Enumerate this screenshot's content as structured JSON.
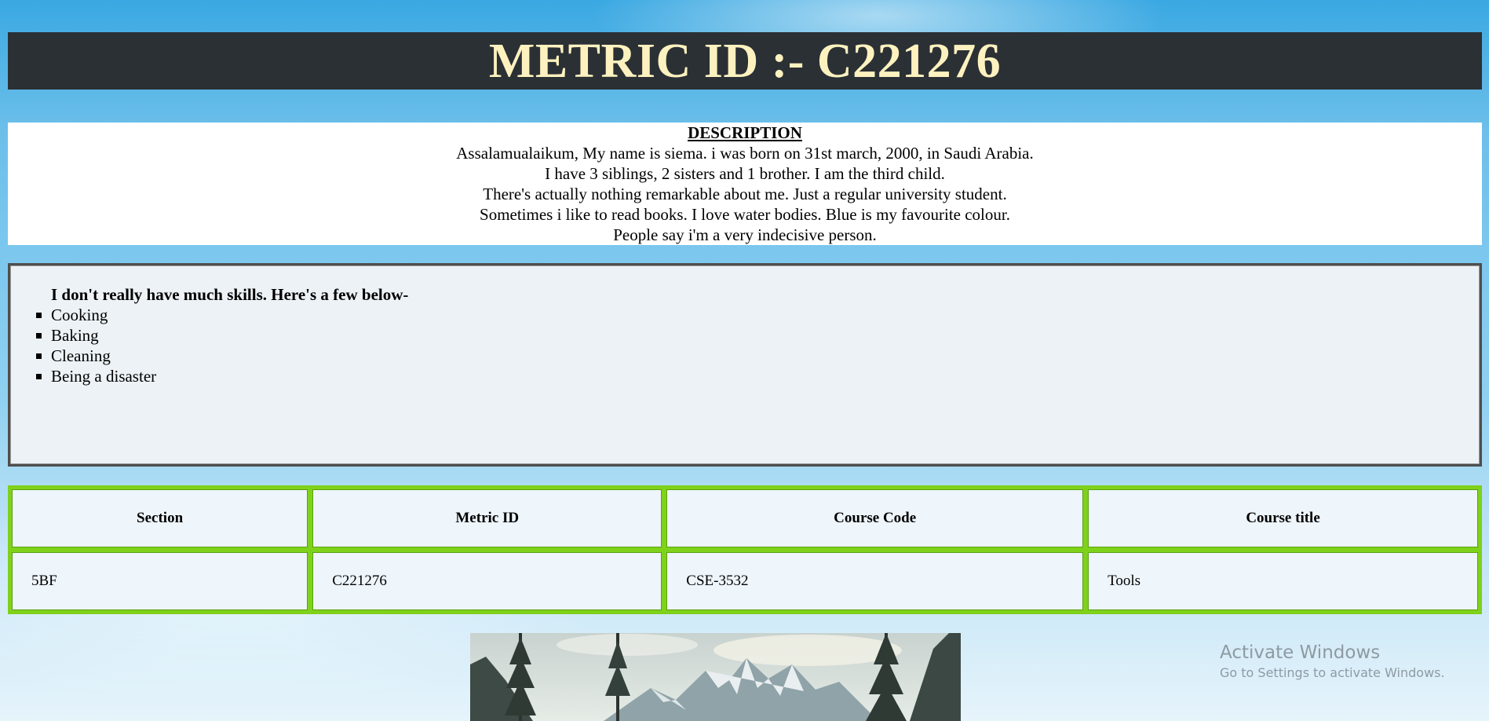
{
  "header": {
    "title": "METRIC ID :- C221276"
  },
  "description": {
    "heading": "DESCRIPTION",
    "lines": [
      "Assalamualaikum, My name is siema. i was born on 31st march, 2000, in Saudi Arabia.",
      "I have 3 siblings, 2 sisters and 1 brother. I am the third child.",
      "There's actually nothing remarkable about me. Just a regular university student.",
      "Sometimes i like to read books. I love water bodies. Blue is my favourite colour.",
      "People say i'm a very indecisive person."
    ]
  },
  "skills": {
    "intro": "I don't really have much skills. Here's a few below-",
    "items": [
      "Cooking",
      "Baking",
      "Cleaning",
      "Being a disaster"
    ]
  },
  "table": {
    "headers": [
      "Section",
      "Metric ID",
      "Course Code",
      "Course title"
    ],
    "rows": [
      [
        "5BF",
        "C221276",
        "CSE-3532",
        "Tools"
      ]
    ]
  },
  "watermark": {
    "title": "Activate Windows",
    "subtitle": "Go to Settings to activate Windows."
  },
  "colors": {
    "header_bg": "#2b3035",
    "header_text": "#fdf2bf",
    "table_border": "#7fd21a",
    "skills_bg": "#ecf2f6"
  }
}
